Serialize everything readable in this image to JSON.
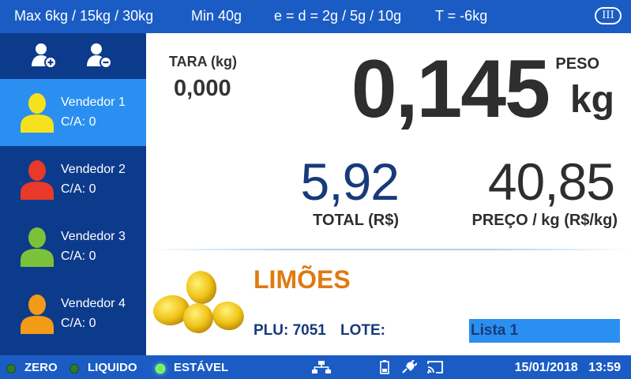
{
  "topbar": {
    "max": "Max 6kg / 15kg / 30kg",
    "min": "Min 40g",
    "division": "e = d = 2g / 5g / 10g",
    "tare_limit": "T = -6kg",
    "class_badge": "III"
  },
  "sidebar": {
    "actions": [
      {
        "icon": "add-user-icon"
      },
      {
        "icon": "remove-user-icon"
      }
    ],
    "vendors": [
      {
        "name": "Vendedor 1",
        "ca": "C/A: 0",
        "color": "#f5e21c",
        "active": true
      },
      {
        "name": "Vendedor 2",
        "ca": "C/A: 0",
        "color": "#e8392a",
        "active": false
      },
      {
        "name": "Vendedor 3",
        "ca": "C/A: 0",
        "color": "#7cc13a",
        "active": false
      },
      {
        "name": "Vendedor 4",
        "ca": "C/A: 0",
        "color": "#f39a16",
        "active": false
      }
    ]
  },
  "scale": {
    "tara_label": "TARA (kg)",
    "tara_value": "0,000",
    "weight": "0,145",
    "peso_label": "PESO",
    "unit": "kg",
    "total_value": "5,92",
    "total_label": "TOTAL (R$)",
    "price_value": "40,85",
    "price_label": "PREÇO / kg (R$/kg)"
  },
  "product": {
    "name": "LIMÕES",
    "plu": "PLU: 7051",
    "lote": "LOTE:",
    "list": "Lista 1",
    "image": "lemons-image"
  },
  "statusbar": {
    "zero": "ZERO",
    "liquido": "LIQUIDO",
    "estavel": "ESTÁVEL",
    "date": "15/01/2018",
    "time": "13:59",
    "icons": [
      "network-icon",
      "battery-icon",
      "power-plug-icon",
      "cast-icon"
    ]
  },
  "colors": {
    "bar": "#1b5cc4",
    "sidebar": "#0d3b8c",
    "active": "#2a8ff0",
    "product_name": "#e07a10",
    "total": "#173a7a"
  }
}
